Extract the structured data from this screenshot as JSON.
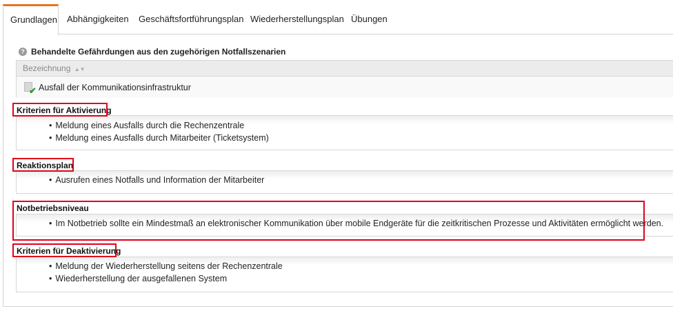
{
  "tabs": [
    {
      "label": "Grundlagen",
      "active": true
    },
    {
      "label": "Abhängigkeiten",
      "active": false
    },
    {
      "label": "Geschäftsfortführungsplan",
      "active": false
    },
    {
      "label": "Wiederherstellungsplan",
      "active": false
    },
    {
      "label": "Übungen",
      "active": false
    }
  ],
  "threats": {
    "title": "Behandelte Gefährdungen aus den zugehörigen Notfallszenarien",
    "column": "Bezeichnung",
    "rows": [
      "Ausfall der Kommunikationsinfrastruktur"
    ]
  },
  "sections": [
    {
      "title": "Kriterien für Aktivierung",
      "items": [
        "Meldung eines Ausfalls durch die Rechenzentrale",
        "Meldung eines Ausfalls durch Mitarbeiter (Ticketsystem)"
      ]
    },
    {
      "title": "Reaktionsplan",
      "items": [
        "Ausrufen eines Notfalls und Information der Mitarbeiter"
      ]
    },
    {
      "title": "Notbetriebsniveau",
      "items": [
        "Im Notbetrieb sollte ein Mindestmaß an elektronischer Kommunikation über mobile Endgeräte für die zeitkritischen Prozesse und Aktivitäten ermöglicht werden."
      ]
    },
    {
      "title": "Kriterien für Deaktivierung",
      "items": [
        "Meldung der Wiederherstellung seitens der Rechenzentrale",
        "Wiederherstellung der ausgefallenen System"
      ]
    }
  ],
  "colors": {
    "accent": "#e8731c",
    "highlight": "#e0001a",
    "check": "#2a9a3c"
  },
  "icons": {
    "help": "help-icon",
    "sort": "sort-asc-icon",
    "row": "document-check-icon"
  }
}
